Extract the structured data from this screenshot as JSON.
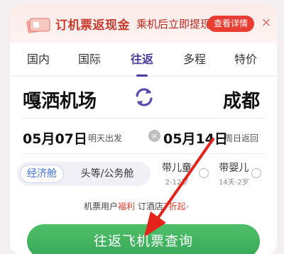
{
  "promo": {
    "title": "订机票返现金",
    "text": "乘机后立即提现",
    "button": "查看详情",
    "close": "×"
  },
  "tabs": [
    {
      "label": "国内",
      "active": false
    },
    {
      "label": "国际",
      "active": false
    },
    {
      "label": "往返",
      "active": true
    },
    {
      "label": "多程",
      "active": false
    },
    {
      "label": "特价",
      "active": false
    }
  ],
  "route": {
    "from": "嘎洒机场",
    "to": "成都"
  },
  "dates": {
    "depart_date": "05月07日",
    "depart_note": "明天出发",
    "return_date": "05月14日",
    "return_note": "周日返回",
    "clear": "×"
  },
  "cabin": {
    "selected": "经济舱",
    "other": "头等/公务舱"
  },
  "passengers": {
    "child_label": "带儿童",
    "child_age": "2-12岁",
    "infant_label": "带婴儿",
    "infant_age": "14天-2岁"
  },
  "benefit": {
    "prefix": "机票用户",
    "highlight": "福利",
    "middle": "订酒店",
    "discount": "7折起",
    "chevron": "›"
  },
  "search_button": "往返飞机票查询",
  "colors": {
    "accent": "#4a3b9c",
    "promo_red": "#e83d33",
    "search_green": "#3fb05d",
    "annotation_red": "#e5231b"
  }
}
